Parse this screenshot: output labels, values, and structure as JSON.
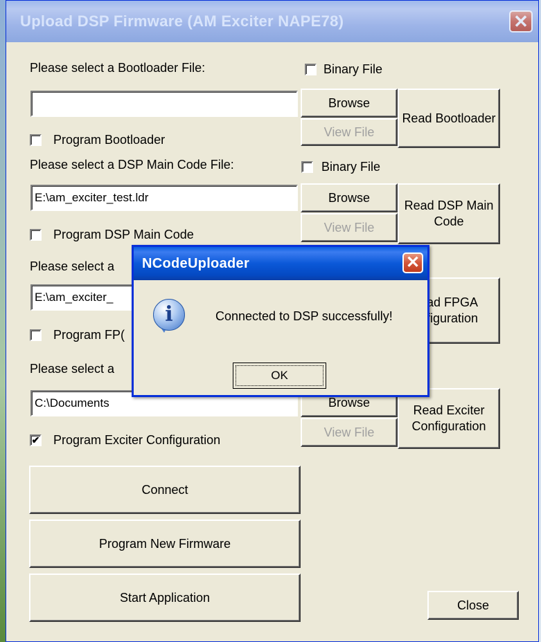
{
  "window": {
    "title": "Upload DSP Firmware (AM Exciter NAPE78)",
    "close_glyph": "✕"
  },
  "bootloader": {
    "prompt": "Please select a Bootloader File:",
    "binary_label": "Binary File",
    "binary_checked": false,
    "path": "",
    "browse_label": "Browse",
    "view_label": "View File",
    "read_label": "Read Bootloader",
    "program_label": "Program Bootloader",
    "program_checked": false
  },
  "main_code": {
    "prompt": "Please select a DSP Main Code File:",
    "binary_label": "Binary File",
    "binary_checked": false,
    "path": "E:\\am_exciter_test.ldr",
    "browse_label": "Browse",
    "view_label": "View File",
    "read_label": "Read DSP Main Code",
    "program_label": "Program DSP Main Code",
    "program_checked": false
  },
  "fpga": {
    "prompt": "Please select a",
    "path": "E:\\am_exciter_",
    "read_label": "ead FPGA\nnfiguration",
    "program_label": "Program FP(",
    "program_checked": false
  },
  "exciter": {
    "prompt": "Please select a",
    "path": "C:\\Documents",
    "browse_label": "Browse",
    "view_label": "View File",
    "read_label": "Read Exciter Configuration",
    "program_label": "Program Exciter Configuration",
    "program_checked": true
  },
  "actions": {
    "connect_label": "Connect",
    "program_new_label": "Program New Firmware",
    "start_label": "Start Application",
    "close_label": "Close"
  },
  "dialog": {
    "title": "NCodeUploader",
    "message": "Connected to DSP successfully!",
    "ok_label": "OK",
    "icon": "info-icon",
    "icon_glyph": "i"
  },
  "check_glyph": "✔"
}
